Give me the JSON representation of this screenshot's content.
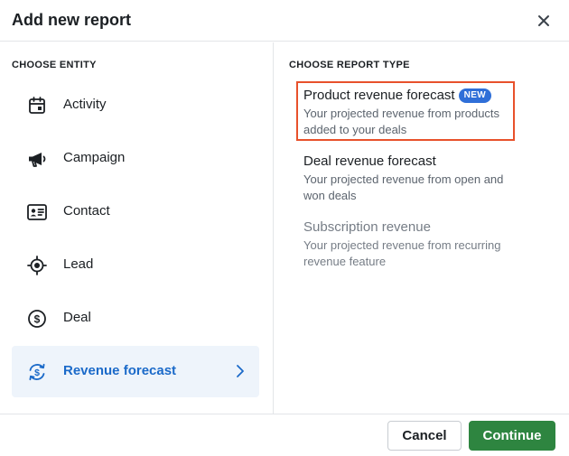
{
  "dialog": {
    "title": "Add new report",
    "close_icon": "close-icon"
  },
  "entities": {
    "heading": "CHOOSE ENTITY",
    "items": [
      {
        "label": "Activity",
        "icon": "calendar-icon",
        "selected": false
      },
      {
        "label": "Campaign",
        "icon": "megaphone-icon",
        "selected": false
      },
      {
        "label": "Contact",
        "icon": "contact-card-icon",
        "selected": false
      },
      {
        "label": "Lead",
        "icon": "target-icon",
        "selected": false
      },
      {
        "label": "Deal",
        "icon": "dollar-circle-icon",
        "selected": false
      },
      {
        "label": "Revenue forecast",
        "icon": "dollar-refresh-icon",
        "selected": true
      }
    ]
  },
  "report_types": {
    "heading": "CHOOSE REPORT TYPE",
    "items": [
      {
        "title": "Product revenue forecast",
        "badge": "NEW",
        "description": "Your projected revenue from products added to your deals",
        "highlighted": true
      },
      {
        "title": "Deal revenue forecast",
        "description": "Your projected revenue from open and won deals"
      },
      {
        "title": "Subscription revenue",
        "description": "Your projected revenue from recurring revenue feature",
        "disabled": true
      }
    ]
  },
  "footer": {
    "cancel_label": "Cancel",
    "continue_label": "Continue"
  },
  "colors": {
    "accent": "#1b6ac9",
    "primary_button": "#2e8540",
    "badge": "#2f6fd8",
    "highlight": "#e8512b"
  }
}
